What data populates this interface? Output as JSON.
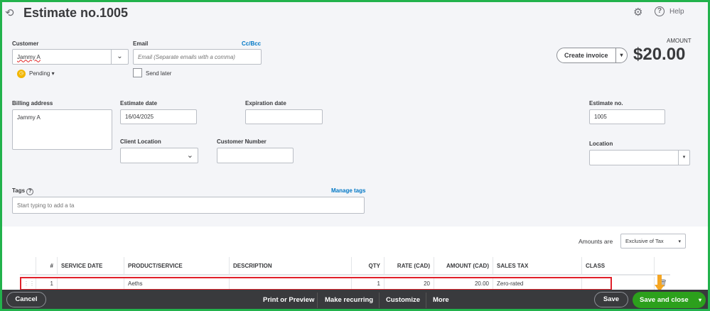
{
  "header": {
    "title": "Estimate no.1005",
    "help_label": "Help"
  },
  "customer": {
    "label": "Customer",
    "value": "Jammy A",
    "status": "Pending"
  },
  "email": {
    "label": "Email",
    "cc_bcc": "Cc/Bcc",
    "placeholder": "Email (Separate emails with a comma)",
    "send_later": "Send later"
  },
  "amount": {
    "label": "AMOUNT",
    "value": "$20.00",
    "create_invoice": "Create invoice"
  },
  "billing": {
    "label": "Billing address",
    "value": "Jammy A"
  },
  "estimate_date": {
    "label": "Estimate date",
    "value": "16/04/2025"
  },
  "expiration_date": {
    "label": "Expiration date",
    "value": ""
  },
  "estimate_no": {
    "label": "Estimate no.",
    "value": "1005"
  },
  "client_location": {
    "label": "Client Location"
  },
  "customer_number": {
    "label": "Customer Number"
  },
  "location": {
    "label": "Location"
  },
  "tags": {
    "label": "Tags",
    "manage": "Manage tags",
    "placeholder": "Start typing to add a ta"
  },
  "amounts_are": {
    "label": "Amounts are",
    "value": "Exclusive of Tax"
  },
  "table": {
    "headers": [
      "#",
      "SERVICE DATE",
      "PRODUCT/SERVICE",
      "DESCRIPTION",
      "QTY",
      "RATE (CAD)",
      "AMOUNT (CAD)",
      "SALES TAX",
      "CLASS"
    ],
    "rows": [
      {
        "num": "1",
        "service_date": "",
        "product": "Aeths",
        "description": "",
        "qty": "1",
        "rate": "20",
        "amount": "20.00",
        "tax": "Zero-rated",
        "class": ""
      }
    ]
  },
  "footer": {
    "cancel": "Cancel",
    "print": "Print or Preview",
    "recurring": "Make recurring",
    "customize": "Customize",
    "more": "More",
    "save": "Save",
    "save_close": "Save and close"
  }
}
